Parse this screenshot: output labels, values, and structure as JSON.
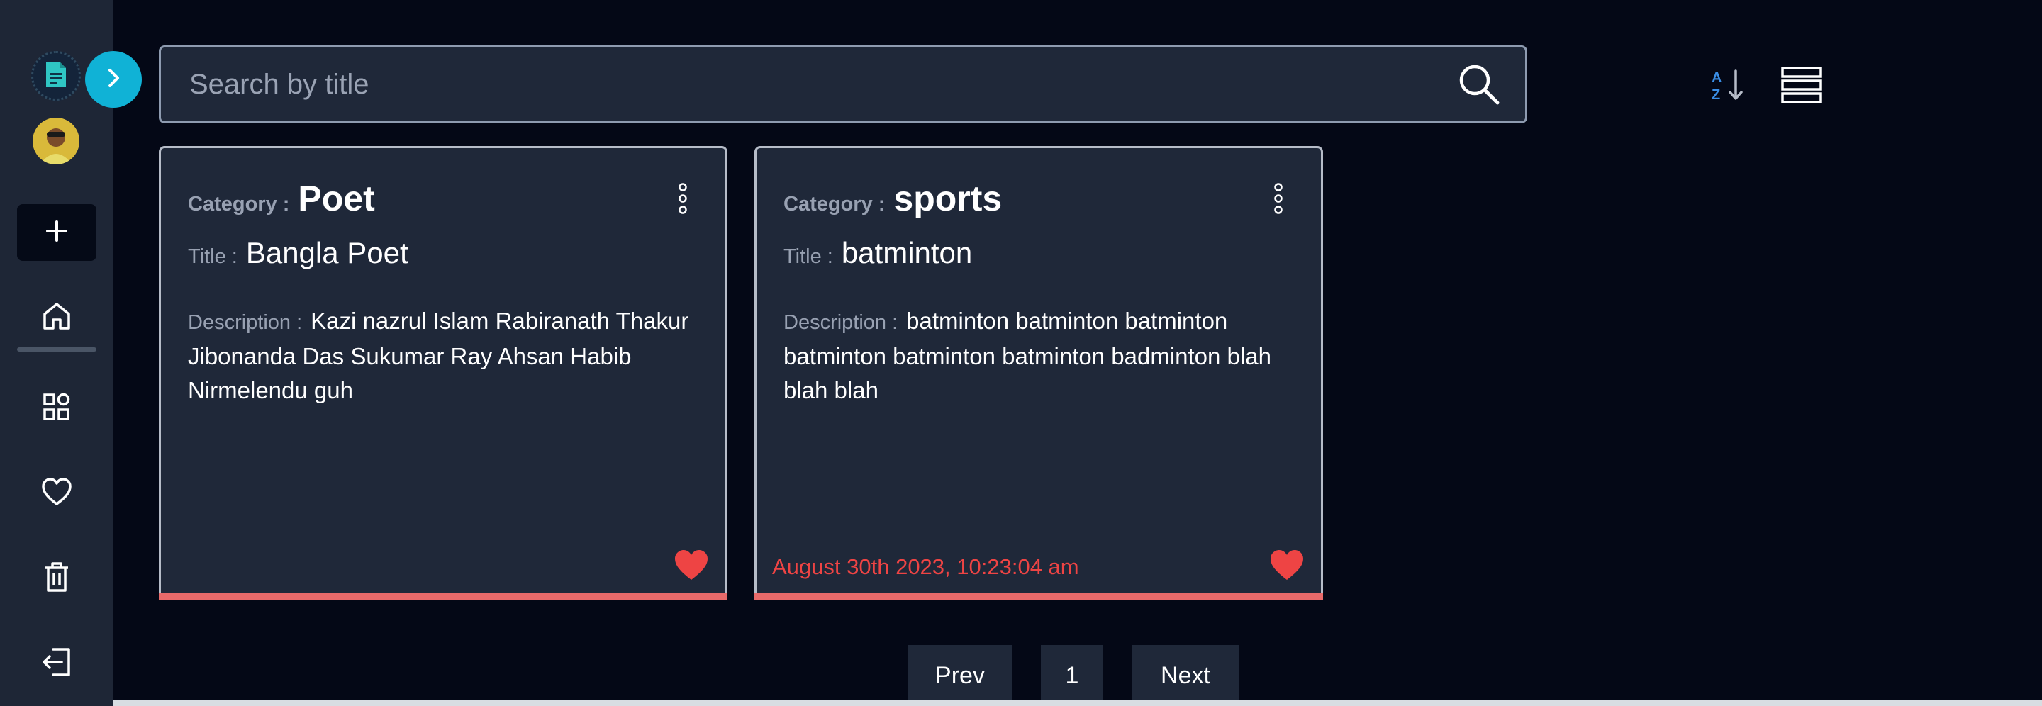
{
  "colors": {
    "background": "#040816",
    "sidebar": "#1e2636",
    "card": "#1f2839",
    "accent_cyan": "#10b2d6",
    "heart_red": "#ee4444",
    "card_bar": "#e86a6a"
  },
  "sidebar": {
    "icons": [
      "document-logo-icon",
      "chevron-right-icon",
      "avatar",
      "plus-icon",
      "home-icon",
      "apps-grid-icon",
      "heart-outline-icon",
      "trash-icon",
      "logout-icon"
    ]
  },
  "search": {
    "placeholder": "Search by title"
  },
  "toolbar": {
    "sort_icon": "sort-az-icon",
    "view_icon": "list-view-icon",
    "sort_letters": [
      "A",
      "Z"
    ]
  },
  "cards": [
    {
      "category_label": "Category :",
      "category": "Poet",
      "title_label": "Title :",
      "title": "Bangla Poet",
      "description_label": "Description :",
      "description": "Kazi nazrul Islam Rabiranath Thakur Jibonanda Das Sukumar Ray Ahsan Habib Nirmelendu guh",
      "date": ""
    },
    {
      "category_label": "Category :",
      "category": "sports",
      "title_label": "Title :",
      "title": "batminton",
      "description_label": "Description :",
      "description": "batminton batminton batminton batminton batminton batminton badminton blah blah blah",
      "date": "August 30th 2023, 10:23:04 am"
    }
  ],
  "pagination": {
    "prev": "Prev",
    "current": "1",
    "next": "Next"
  }
}
